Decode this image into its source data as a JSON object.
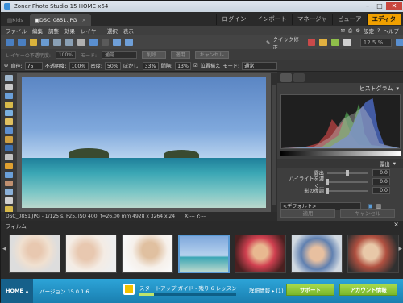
{
  "window": {
    "title": "Zoner Photo Studio 15 HOME x64"
  },
  "tabs": [
    {
      "label": "Kids"
    },
    {
      "label": "DSC_0851.JPG",
      "close": "×"
    }
  ],
  "modes": [
    "ログイン",
    "インポート",
    "マネージャ",
    "ビューア",
    "エディタ"
  ],
  "menu": [
    "ファイル",
    "編集",
    "調整",
    "効果",
    "レイヤー",
    "選択",
    "表示"
  ],
  "menu_right": [
    "設定",
    "ヘルプ"
  ],
  "toolbar": {
    "quick_fix": "クイック修正",
    "zoom": "12.5 %"
  },
  "toolbar2": {
    "layer_opacity_label": "レイヤーの不透明度:",
    "layer_opacity": "100%",
    "mode_label": "モード:",
    "mode": "通常",
    "cancel_btn": "削除...",
    "apply_btn": "適用",
    "cancel_btn2": "キャンセル"
  },
  "tool_options": {
    "diameter_label": "直径:",
    "diameter": "75",
    "opacity_label": "不透明度:",
    "opacity": "100%",
    "density_label": "密度:",
    "density": "50%",
    "blur_label": "ぼかし:",
    "blur": "33%",
    "spacing_label": "間隔:",
    "spacing": "13%",
    "align_label": "位置揃え",
    "mode_label": "モード:",
    "mode": "通常"
  },
  "infobar": {
    "file": "DSC_0851.JPG - 1/125 s, F25, ISO 400, f=26.00 mm   4928 x 3264 x 24",
    "coords": "X:---  Y:---"
  },
  "panel": {
    "histogram": "ヒストグラム",
    "exposure_section": "露出",
    "rows": [
      {
        "label": "露出",
        "value": "0.0",
        "knob": 0.5
      },
      {
        "label": "ハイライトを濃く...",
        "value": "0.0",
        "knob": 0.0
      },
      {
        "label": "影の復調",
        "value": "0.0",
        "knob": 0.0
      }
    ],
    "preset": "<デフォルト>",
    "apply": "適用",
    "cancel": "キャンセル"
  },
  "filmstrip": {
    "title": "フィルム",
    "close": "×",
    "count": 7,
    "selected_index": 3
  },
  "bottom": {
    "home": "HOME",
    "version": "バージョン 15.0.1.6",
    "guide": "スタートアップ ガイド - 残り 6 レッスン",
    "details": "詳細情報 ▸ (1)",
    "support": "サポート",
    "account": "アカウント情報",
    "progress": 0.15
  },
  "colors": {
    "accent": "#f0a000",
    "bottom_bar": "#1a8fc4",
    "green_btn": "#8cc63f"
  },
  "icons": [
    "zoom-icon",
    "move-icon",
    "crop-icon",
    "brush-icon",
    "eraser-icon",
    "clone-icon",
    "color-picker-icon"
  ]
}
